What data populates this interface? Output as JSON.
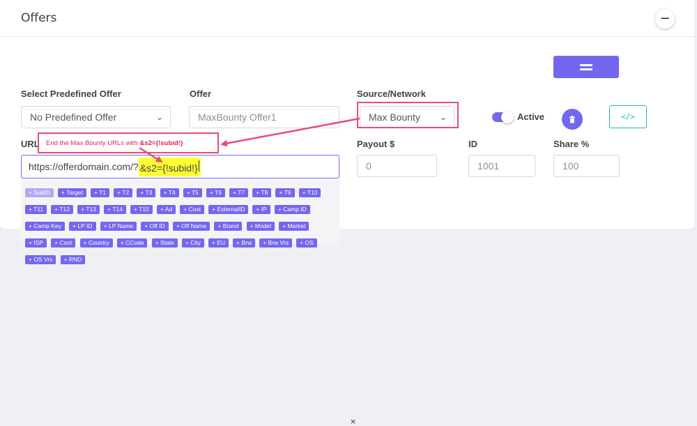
{
  "card": {
    "title": "Offers",
    "collapse_symbol": "−"
  },
  "colors": {
    "accent": "#7367f0",
    "annotation": "#e84a7f",
    "highlight": "#ffff33",
    "info": "#1ab7c4"
  },
  "icons": {
    "menu": "menu-icon",
    "trash": "trash-icon",
    "code": "code-icon",
    "collapse": "minus-icon",
    "chevron": "chevron-down-icon"
  },
  "form": {
    "predefined": {
      "label": "Select Predefined Offer",
      "value": "No Predefined Offer"
    },
    "offer": {
      "label": "Offer",
      "placeholder": "MaxBounty Offer1"
    },
    "source": {
      "label": "Source/Network",
      "value": "Max Bounty"
    },
    "active": {
      "label": "Active",
      "on": true
    },
    "code_button_label": "</>",
    "url": {
      "label": "URL",
      "value_prefix": "https://offerdomain.com/?",
      "value_highlight": "&s2={!subid!}"
    },
    "payout": {
      "label": "Payout $",
      "placeholder": "0"
    },
    "id": {
      "label": "ID",
      "placeholder": "1001"
    },
    "share": {
      "label": "Share %",
      "placeholder": "100"
    }
  },
  "annotation": {
    "text": "End the Max Bounty URLs with",
    "code": "&s2={!subid!}"
  },
  "tags": [
    "+ SubID",
    "+ Target",
    "+ T1",
    "+ T2",
    "+ T3",
    "+ T4",
    "+ T5",
    "+ T6",
    "+ T7",
    "+ T8",
    "+ T9",
    "+ T10",
    "+ T11",
    "+ T12",
    "+ T13",
    "+ T14",
    "+ T15",
    "+ Ad",
    "+ Cost",
    "+ ExternalID",
    "+ IP",
    "+ Camp ID",
    "+ Camp Key",
    "+ LP ID",
    "+ LP Name",
    "+ Off ID",
    "+ Off Name",
    "+ Brand",
    "+ Model",
    "+ Market",
    "+ ISP",
    "+ Cont",
    "+ Country",
    "+ CCode",
    "+ State",
    "+ City",
    "+ EU",
    "+ Brw",
    "+ Brw Vrs",
    "+ OS",
    "+ OS Vrs",
    "+ RND"
  ],
  "tags_close": "×"
}
